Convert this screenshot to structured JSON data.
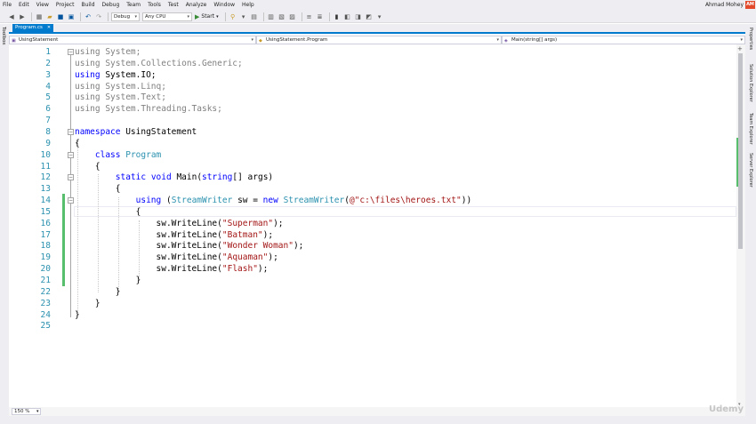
{
  "menu": [
    "File",
    "Edit",
    "View",
    "Project",
    "Build",
    "Debug",
    "Team",
    "Tools",
    "Test",
    "Analyze",
    "Window",
    "Help"
  ],
  "user": {
    "name": "Ahmad Mohey",
    "initials": "AM"
  },
  "toolbar": {
    "config": "Debug",
    "platform": "Any CPU",
    "start_label": "Start"
  },
  "left_strip": {
    "label": "Toolbox"
  },
  "right_strip": {
    "tabs": [
      "Properties",
      "Solution Explorer",
      "Team Explorer",
      "Server Explorer"
    ]
  },
  "tab": {
    "label": "Program.cs",
    "close": "✕"
  },
  "navbar": {
    "project": "UsingStatement",
    "class": "UsingStatement.Program",
    "member": "Main(string[] args)"
  },
  "zoom": "150 %",
  "watermark": "Udemy",
  "code": [
    {
      "n": "1",
      "tokens": [
        {
          "c": "dim",
          "t": "using System;"
        }
      ]
    },
    {
      "n": "2",
      "tokens": [
        {
          "c": "dim",
          "t": "using System.Collections.Generic;"
        }
      ]
    },
    {
      "n": "3",
      "tokens": [
        {
          "c": "kw",
          "t": "using"
        },
        {
          "c": "tx",
          "t": " System.IO;"
        }
      ]
    },
    {
      "n": "4",
      "tokens": [
        {
          "c": "dim",
          "t": "using System.Linq;"
        }
      ]
    },
    {
      "n": "5",
      "tokens": [
        {
          "c": "dim",
          "t": "using System.Text;"
        }
      ]
    },
    {
      "n": "6",
      "tokens": [
        {
          "c": "dim",
          "t": "using System.Threading.Tasks;"
        }
      ]
    },
    {
      "n": "7",
      "tokens": []
    },
    {
      "n": "8",
      "tokens": [
        {
          "c": "kw",
          "t": "namespace"
        },
        {
          "c": "tx",
          "t": " UsingStatement"
        }
      ]
    },
    {
      "n": "9",
      "tokens": [
        {
          "c": "tx",
          "t": "{"
        }
      ]
    },
    {
      "n": "10",
      "tokens": [
        {
          "c": "tx",
          "t": "    "
        },
        {
          "c": "kw",
          "t": "class"
        },
        {
          "c": "tx",
          "t": " "
        },
        {
          "c": "ty",
          "t": "Program"
        }
      ]
    },
    {
      "n": "11",
      "tokens": [
        {
          "c": "tx",
          "t": "    {"
        }
      ]
    },
    {
      "n": "12",
      "tokens": [
        {
          "c": "tx",
          "t": "        "
        },
        {
          "c": "kw",
          "t": "static"
        },
        {
          "c": "tx",
          "t": " "
        },
        {
          "c": "kw",
          "t": "void"
        },
        {
          "c": "tx",
          "t": " Main("
        },
        {
          "c": "kw",
          "t": "string"
        },
        {
          "c": "tx",
          "t": "[] args)"
        }
      ]
    },
    {
      "n": "13",
      "tokens": [
        {
          "c": "tx",
          "t": "        {"
        }
      ]
    },
    {
      "n": "14",
      "tokens": [
        {
          "c": "tx",
          "t": "            "
        },
        {
          "c": "kw",
          "t": "using"
        },
        {
          "c": "tx",
          "t": " ("
        },
        {
          "c": "ty",
          "t": "StreamWriter"
        },
        {
          "c": "tx",
          "t": " sw = "
        },
        {
          "c": "kw",
          "t": "new"
        },
        {
          "c": "tx",
          "t": " "
        },
        {
          "c": "ty",
          "t": "StreamWriter"
        },
        {
          "c": "tx",
          "t": "("
        },
        {
          "c": "st",
          "t": "@\"c:\\files\\heroes.txt\""
        },
        {
          "c": "tx",
          "t": "))"
        }
      ]
    },
    {
      "n": "15",
      "tokens": [
        {
          "c": "tx",
          "t": "            {"
        }
      ]
    },
    {
      "n": "16",
      "tokens": [
        {
          "c": "tx",
          "t": "                sw.WriteLine("
        },
        {
          "c": "st",
          "t": "\"Superman\""
        },
        {
          "c": "tx",
          "t": ");"
        }
      ]
    },
    {
      "n": "17",
      "tokens": [
        {
          "c": "tx",
          "t": "                sw.WriteLine("
        },
        {
          "c": "st",
          "t": "\"Batman\""
        },
        {
          "c": "tx",
          "t": ");"
        }
      ]
    },
    {
      "n": "18",
      "tokens": [
        {
          "c": "tx",
          "t": "                sw.WriteLine("
        },
        {
          "c": "st",
          "t": "\"Wonder Woman\""
        },
        {
          "c": "tx",
          "t": ");"
        }
      ]
    },
    {
      "n": "19",
      "tokens": [
        {
          "c": "tx",
          "t": "                sw.WriteLine("
        },
        {
          "c": "st",
          "t": "\"Aquaman\""
        },
        {
          "c": "tx",
          "t": ");"
        }
      ]
    },
    {
      "n": "20",
      "tokens": [
        {
          "c": "tx",
          "t": "                sw.WriteLine("
        },
        {
          "c": "st",
          "t": "\"Flash\""
        },
        {
          "c": "tx",
          "t": ");"
        }
      ]
    },
    {
      "n": "21",
      "tokens": [
        {
          "c": "tx",
          "t": "            }"
        }
      ]
    },
    {
      "n": "22",
      "tokens": [
        {
          "c": "tx",
          "t": "        }"
        }
      ]
    },
    {
      "n": "23",
      "tokens": [
        {
          "c": "tx",
          "t": "    }"
        }
      ]
    },
    {
      "n": "24",
      "tokens": [
        {
          "c": "tx",
          "t": "}"
        }
      ]
    },
    {
      "n": "25",
      "tokens": []
    }
  ]
}
